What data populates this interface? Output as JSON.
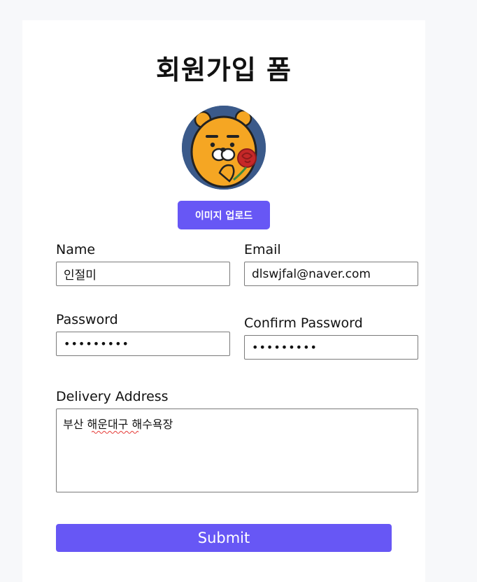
{
  "form": {
    "title": "회원가입 폼",
    "upload_label": "이미지 업로드",
    "name": {
      "label": "Name",
      "value": "인절미"
    },
    "email": {
      "label": "Email",
      "value": "dlswjfal@naver.com"
    },
    "password": {
      "label": "Password",
      "value": "123456789"
    },
    "confirm_password": {
      "label": "Confirm Password",
      "value": "123456789"
    },
    "address": {
      "label": "Delivery Address",
      "value": "부산 해운대구 해수욕장"
    },
    "submit_label": "Submit"
  },
  "colors": {
    "accent": "#6757f5",
    "avatar_bg": "#3b5a8a",
    "character": "#f5a623"
  },
  "icons": {
    "avatar": "lion-character-avatar"
  }
}
